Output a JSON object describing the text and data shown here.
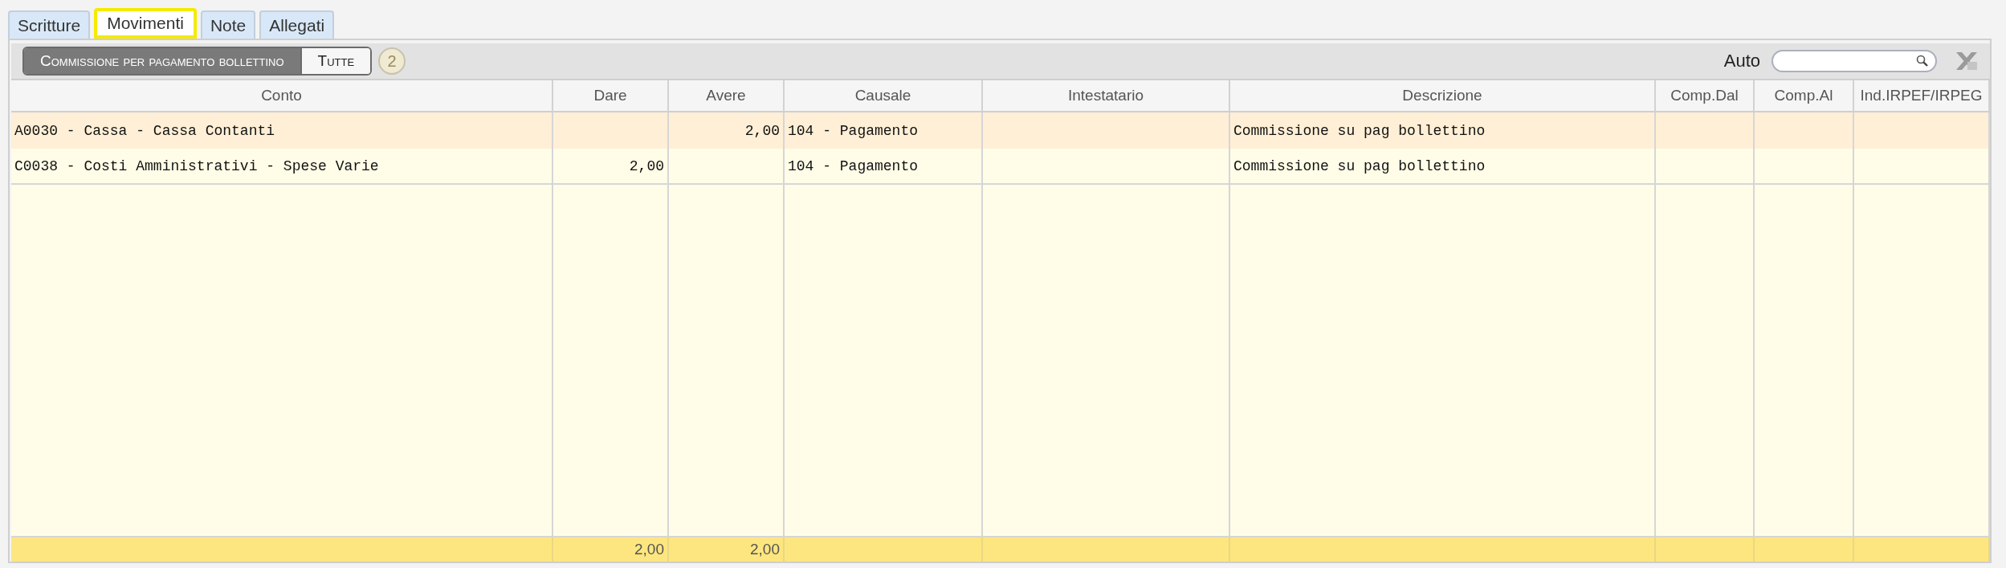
{
  "tabs": [
    {
      "label": "Scritture",
      "selected": false
    },
    {
      "label": "Movimenti",
      "selected": true
    },
    {
      "label": "Note",
      "selected": false
    },
    {
      "label": "Allegati",
      "selected": false
    }
  ],
  "toolbar": {
    "filters": [
      {
        "label": "Commissione per pagamento bollettino",
        "selected": true
      },
      {
        "label": "Tutte",
        "selected": false
      }
    ],
    "count": "2",
    "search_label": "Auto"
  },
  "table": {
    "columns": [
      "Conto",
      "Dare",
      "Avere",
      "Causale",
      "Intestatario",
      "Descrizione",
      "Comp.Dal",
      "Comp.Al",
      "Ind.IRPEF/IRPEG"
    ],
    "rows": [
      {
        "selected": true,
        "conto": "A0030 - Cassa - Cassa Contanti",
        "avere": "2,00",
        "causale": "104 - Pagamento",
        "descrizione": "Commissione su pag bollettino"
      },
      {
        "selected": false,
        "conto": "C0038 - Costi Amministrativi - Spese Varie",
        "dare": "2,00",
        "causale": "104 - Pagamento",
        "descrizione": "Commissione su pag bollettino"
      }
    ],
    "totals": {
      "dare": "2,00",
      "avere": "2,00"
    }
  }
}
